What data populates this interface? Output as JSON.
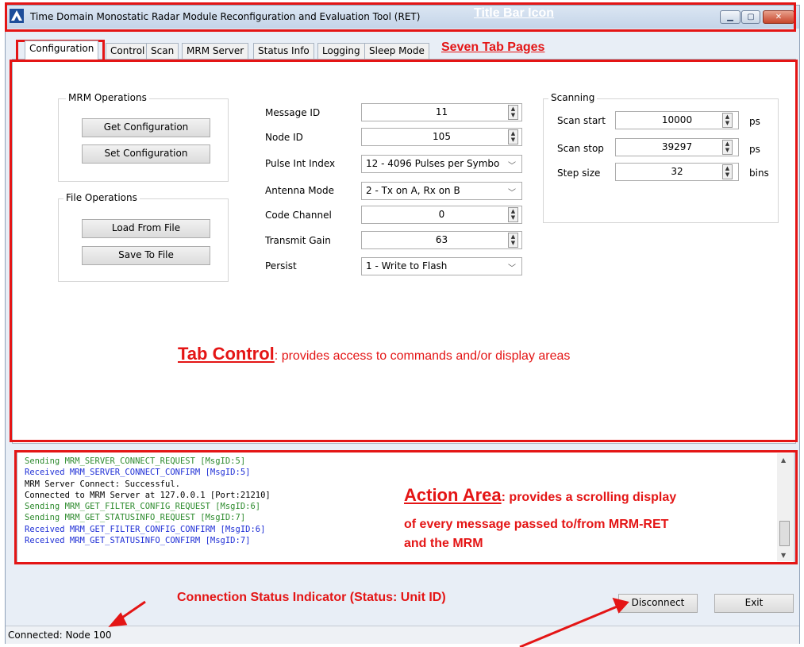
{
  "window": {
    "title": "Time Domain Monostatic Radar Module Reconfiguration and Evaluation Tool (RET)",
    "controls": {
      "minimize": "▁",
      "maximize": "▢",
      "close": "✕"
    }
  },
  "tabs": [
    {
      "label": "Configuration",
      "active": true
    },
    {
      "label": "Control"
    },
    {
      "label": "Scan"
    },
    {
      "label": "MRM Server"
    },
    {
      "label": "Status Info"
    },
    {
      "label": "Logging"
    },
    {
      "label": "Sleep Mode"
    }
  ],
  "mrm_operations": {
    "title": "MRM Operations",
    "get_configuration": "Get Configuration",
    "set_configuration": "Set Configuration"
  },
  "file_operations": {
    "title": "File Operations",
    "load_from_file": "Load From File",
    "save_to_file": "Save To File"
  },
  "config_fields": {
    "message_id": {
      "label": "Message ID",
      "value": "11"
    },
    "node_id": {
      "label": "Node ID",
      "value": "105"
    },
    "pulse_int_index": {
      "label": "Pulse Int Index",
      "value": "12 - 4096 Pulses per Symbo"
    },
    "antenna_mode": {
      "label": "Antenna Mode",
      "value": "2 - Tx on A, Rx on B"
    },
    "code_channel": {
      "label": "Code Channel",
      "value": "0"
    },
    "transmit_gain": {
      "label": "Transmit Gain",
      "value": "63"
    },
    "persist": {
      "label": "Persist",
      "value": "1 - Write to Flash"
    }
  },
  "scanning": {
    "title": "Scanning",
    "scan_start": {
      "label": "Scan start",
      "value": "10000",
      "unit": "ps"
    },
    "scan_stop": {
      "label": "Scan stop",
      "value": "39297",
      "unit": "ps"
    },
    "step_size": {
      "label": "Step size",
      "value": "32",
      "unit": "bins"
    }
  },
  "log_lines": [
    {
      "text": "Sending MRM_SERVER_CONNECT_REQUEST [MsgID:5]",
      "color": "#2e8b2e"
    },
    {
      "text": "Received MRM_SERVER_CONNECT_CONFIRM [MsgID:5]",
      "color": "#1f2fd6"
    },
    {
      "text": "MRM Server Connect: Successful.",
      "color": "#000000"
    },
    {
      "text": "Connected to MRM Server at 127.0.0.1 [Port:21210]",
      "color": "#000000"
    },
    {
      "text": "Sending MRM_GET_FILTER_CONFIG_REQUEST [MsgID:6]",
      "color": "#2e8b2e"
    },
    {
      "text": "Sending MRM_GET_STATUSINFO_REQUEST [MsgID:7]",
      "color": "#2e8b2e"
    },
    {
      "text": "Received MRM_GET_FILTER_CONFIG_CONFIRM [MsgID:6]",
      "color": "#1f2fd6"
    },
    {
      "text": "Received MRM_GET_STATUSINFO_CONFIRM [MsgID:7]",
      "color": "#1f2fd6"
    }
  ],
  "buttons": {
    "disconnect": "Disconnect",
    "exit": "Exit"
  },
  "status_bar": {
    "text": "Connected: Node 100"
  },
  "annotations": {
    "title_bar_icon": "Title Bar Icon",
    "seven_tab_pages": "Seven Tab Pages",
    "tab_control_title": "Tab Control",
    "tab_control_desc": ": provides access to commands and/or display areas",
    "action_area_title": "Action Area",
    "action_area_line1": ": provides a scrolling display",
    "action_area_line2": "of every message passed to/from MRM-RET",
    "action_area_line3": "and the MRM",
    "connection_status": "Connection Status Indicator (Status: Unit ID)"
  },
  "colors": {
    "annotation_red": "#e41515",
    "log_green": "#2e8b2e",
    "log_blue": "#1f2fd6"
  }
}
